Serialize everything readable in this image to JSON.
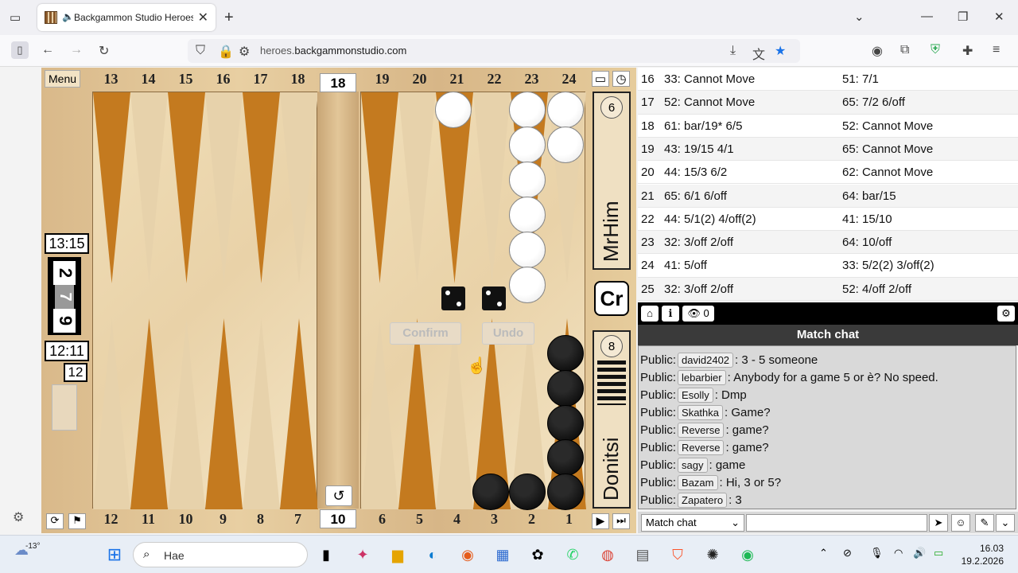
{
  "browser": {
    "tab_title": "Backgammon Studio Heroes",
    "url_domain": "backgammonstudio.com",
    "url_sub": "heroes."
  },
  "game": {
    "menu_label": "Menu",
    "top_numbers_left": [
      "13",
      "14",
      "15",
      "16",
      "17",
      "18"
    ],
    "top_numbers_right": [
      "19",
      "20",
      "21",
      "22",
      "23",
      "24"
    ],
    "bottom_numbers_left": [
      "12",
      "11",
      "10",
      "9",
      "8",
      "7"
    ],
    "bottom_numbers_right": [
      "6",
      "5",
      "4",
      "3",
      "2",
      "1"
    ],
    "cube_top": "18",
    "cube_bottom": "10",
    "top_clock": "13:15",
    "bottom_clock": "12:11",
    "score_top": "2",
    "score_mid": "7",
    "score_bottom": "9",
    "match_length": "12",
    "player_top": "MrHim",
    "player_bottom": "Donitsi",
    "pip_top": "6",
    "pip_bottom": "8",
    "badge": "Cr",
    "confirm_label": "Confirm",
    "undo_label": "Undo",
    "dice": [
      2,
      2
    ]
  },
  "moves": [
    {
      "n": "16",
      "a": "33: Cannot Move",
      "b": "51: 7/1"
    },
    {
      "n": "17",
      "a": "52: Cannot Move",
      "b": "65: 7/2 6/off"
    },
    {
      "n": "18",
      "a": "61: bar/19* 6/5",
      "b": "52: Cannot Move"
    },
    {
      "n": "19",
      "a": "43: 19/15 4/1",
      "b": "65: Cannot Move"
    },
    {
      "n": "20",
      "a": "44: 15/3 6/2",
      "b": "62: Cannot Move"
    },
    {
      "n": "21",
      "a": "65: 6/1 6/off",
      "b": "64: bar/15"
    },
    {
      "n": "22",
      "a": "44: 5/1(2) 4/off(2)",
      "b": "41: 15/10"
    },
    {
      "n": "23",
      "a": "32: 3/off 2/off",
      "b": "64: 10/off"
    },
    {
      "n": "24",
      "a": "41: 5/off",
      "b": "33: 5/2(2) 3/off(2)"
    },
    {
      "n": "25",
      "a": "32: 3/off 2/off",
      "b": "52: 4/off 2/off"
    }
  ],
  "chat": {
    "spectators": "0",
    "title": "Match chat",
    "lines": [
      {
        "prefix": "Public:",
        "user": "david2402",
        "text": ": 3 - 5 someone"
      },
      {
        "prefix": "Public:",
        "user": "lebarbier",
        "text": ": Anybody for a game 5 or è? No speed."
      },
      {
        "prefix": "Public:",
        "user": "Esolly",
        "text": ": Dmp"
      },
      {
        "prefix": "Public:",
        "user": "Skathka",
        "text": ": Game?"
      },
      {
        "prefix": "Public:",
        "user": "Reverse",
        "text": ": game?"
      },
      {
        "prefix": "Public:",
        "user": "Reverse",
        "text": ": game?"
      },
      {
        "prefix": "Public:",
        "user": "sagy",
        "text": ": game"
      },
      {
        "prefix": "Public:",
        "user": "Bazam",
        "text": ": Hi, 3 or 5?"
      },
      {
        "prefix": "Public:",
        "user": "Zapatero",
        "text": ": 3"
      }
    ],
    "channel_select": "Match chat"
  },
  "taskbar": {
    "weather": "-13°",
    "search_placeholder": "Hae",
    "time": "16.03",
    "date": "19.2.2026"
  }
}
